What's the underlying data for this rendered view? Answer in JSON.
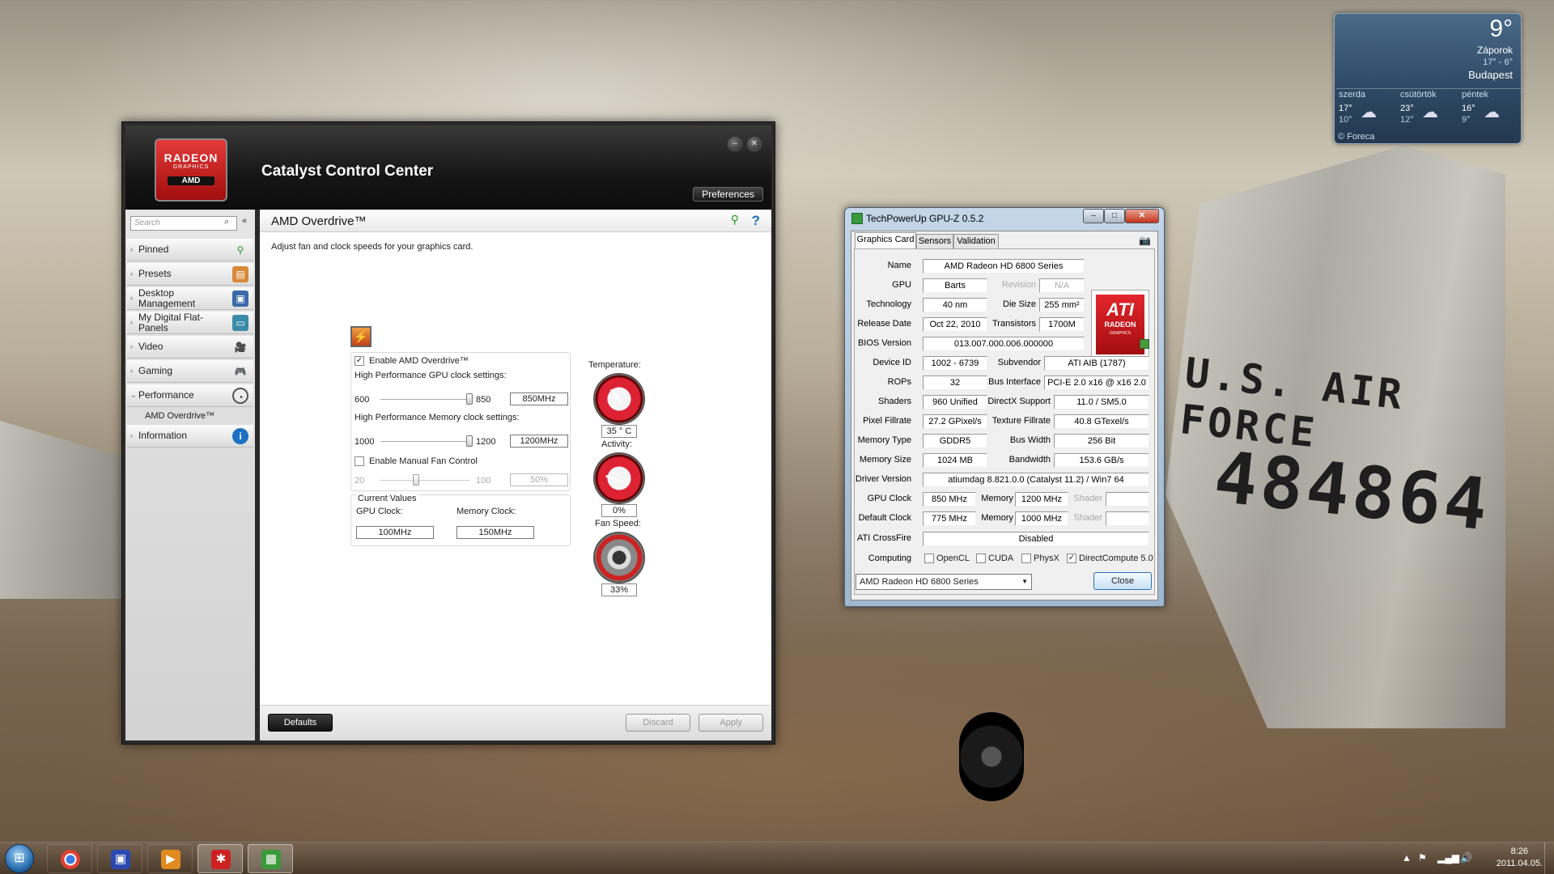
{
  "wallpaper": {
    "aircraft_text": "U.S. AIR FORCE",
    "aircraft_number": "484864"
  },
  "ccc": {
    "logo": {
      "brand": "RADEON",
      "sub": "GRAPHICS",
      "vendor": "AMD"
    },
    "title": "Catalyst Control Center",
    "preferences_label": "Preferences",
    "search_placeholder": "Search",
    "nav": [
      {
        "label": "Pinned",
        "icon": "pin-icon"
      },
      {
        "label": "Presets",
        "icon": "presets-icon"
      },
      {
        "label": "Desktop Management",
        "icon": "desktop-management-icon"
      },
      {
        "label": "My Digital Flat-Panels",
        "icon": "monitor-icon"
      },
      {
        "label": "Video",
        "icon": "video-icon"
      },
      {
        "label": "Gaming",
        "icon": "gamepad-icon"
      },
      {
        "label": "Performance",
        "icon": "gauge-icon"
      },
      {
        "label": "Information",
        "icon": "info-icon"
      }
    ],
    "nav_sub_item": "AMD Overdrive™",
    "page_title": "AMD Overdrive™",
    "page_description": "Adjust fan and clock speeds for your graphics card.",
    "enable_overdrive_label": "Enable AMD Overdrive™",
    "gpu_clock_settings_label": "High Performance GPU clock settings:",
    "gpu_slider": {
      "min": "600",
      "max": "850",
      "value": "850MHz",
      "fraction": 1.0
    },
    "mem_clock_settings_label": "High Performance Memory clock settings:",
    "mem_slider": {
      "min": "1000",
      "max": "1200",
      "value": "1200MHz",
      "fraction": 1.0
    },
    "manual_fan_label": "Enable Manual Fan Control",
    "fan_slider": {
      "min": "20",
      "max": "100",
      "value": "50%",
      "fraction": 0.375
    },
    "current_values_label": "Current Values",
    "gpu_clock_label": "GPU Clock:",
    "gpu_clock_value": "100MHz",
    "memory_clock_label": "Memory Clock:",
    "memory_clock_value": "150MHz",
    "temperature_label": "Temperature:",
    "temperature_value": "35 ° C",
    "activity_label": "Activity:",
    "activity_value": "0%",
    "fan_speed_label": "Fan Speed:",
    "fan_speed_value": "33%",
    "defaults_label": "Defaults",
    "discard_label": "Discard",
    "apply_label": "Apply"
  },
  "gpuz": {
    "title": "TechPowerUp GPU-Z 0.5.2",
    "tabs": [
      "Graphics Card",
      "Sensors",
      "Validation"
    ],
    "logo": {
      "brand": "ATI",
      "sub": "RADEON",
      "tag": "GRAPHICS"
    },
    "fields": {
      "name_label": "Name",
      "name": "AMD Radeon HD 6800 Series",
      "gpu_label": "GPU",
      "gpu": "Barts",
      "revision_label": "Revision",
      "revision": "N/A",
      "technology_label": "Technology",
      "technology": "40 nm",
      "die_size_label": "Die Size",
      "die_size": "255 mm²",
      "release_date_label": "Release Date",
      "release_date": "Oct 22, 2010",
      "transistors_label": "Transistors",
      "transistors": "1700M",
      "bios_label": "BIOS Version",
      "bios": "013.007.000.006.000000",
      "device_id_label": "Device ID",
      "device_id": "1002 - 6739",
      "subvendor_label": "Subvendor",
      "subvendor": "ATI AIB (1787)",
      "rops_label": "ROPs",
      "rops": "32",
      "bus_interface_label": "Bus Interface",
      "bus_interface": "PCI-E 2.0 x16 @ x16 2.0",
      "shaders_label": "Shaders",
      "shaders": "960 Unified",
      "directx_label": "DirectX Support",
      "directx": "11.0 / SM5.0",
      "pixel_fillrate_label": "Pixel Fillrate",
      "pixel_fillrate": "27.2 GPixel/s",
      "texture_fillrate_label": "Texture Fillrate",
      "texture_fillrate": "40.8 GTexel/s",
      "memory_type_label": "Memory Type",
      "memory_type": "GDDR5",
      "bus_width_label": "Bus Width",
      "bus_width": "256 Bit",
      "memory_size_label": "Memory Size",
      "memory_size": "1024 MB",
      "bandwidth_label": "Bandwidth",
      "bandwidth": "153.6 GB/s",
      "driver_label": "Driver Version",
      "driver": "atiumdag 8.821.0.0 (Catalyst 11.2) / Win7 64",
      "gpu_clock_label": "GPU Clock",
      "gpu_clock": "850 MHz",
      "memory_label": "Memory",
      "memory_clock": "1200 MHz",
      "shader_label": "Shader",
      "shader_clock": "",
      "default_clock_label": "Default Clock",
      "default_clock": "775 MHz",
      "default_memory_clock": "1000 MHz",
      "default_shader_clock": "",
      "crossfire_label": "ATI CrossFire",
      "crossfire": "Disabled",
      "computing_label": "Computing"
    },
    "computing": [
      {
        "label": "OpenCL",
        "checked": false
      },
      {
        "label": "CUDA",
        "checked": false
      },
      {
        "label": "PhysX",
        "checked": false
      },
      {
        "label": "DirectCompute 5.0",
        "checked": true
      }
    ],
    "card_select": "AMD Radeon HD 6800 Series",
    "close_label": "Close"
  },
  "weather": {
    "temp": "9°",
    "condition": "Záporok",
    "range": "17° - 6°",
    "city": "Budapest",
    "days": [
      {
        "name": "szerda",
        "hi": "17°",
        "lo": "10°"
      },
      {
        "name": "csütörtök",
        "hi": "23°",
        "lo": "12°"
      },
      {
        "name": "péntek",
        "hi": "16°",
        "lo": "9°"
      }
    ],
    "credit": "© Foreca"
  },
  "taskbar": {
    "apps": [
      {
        "name": "chrome-icon"
      },
      {
        "name": "save-disk-icon"
      },
      {
        "name": "media-player-icon"
      },
      {
        "name": "catalyst-icon"
      },
      {
        "name": "gpuz-icon"
      }
    ],
    "time": "8:26",
    "date": "2011.04.05."
  }
}
